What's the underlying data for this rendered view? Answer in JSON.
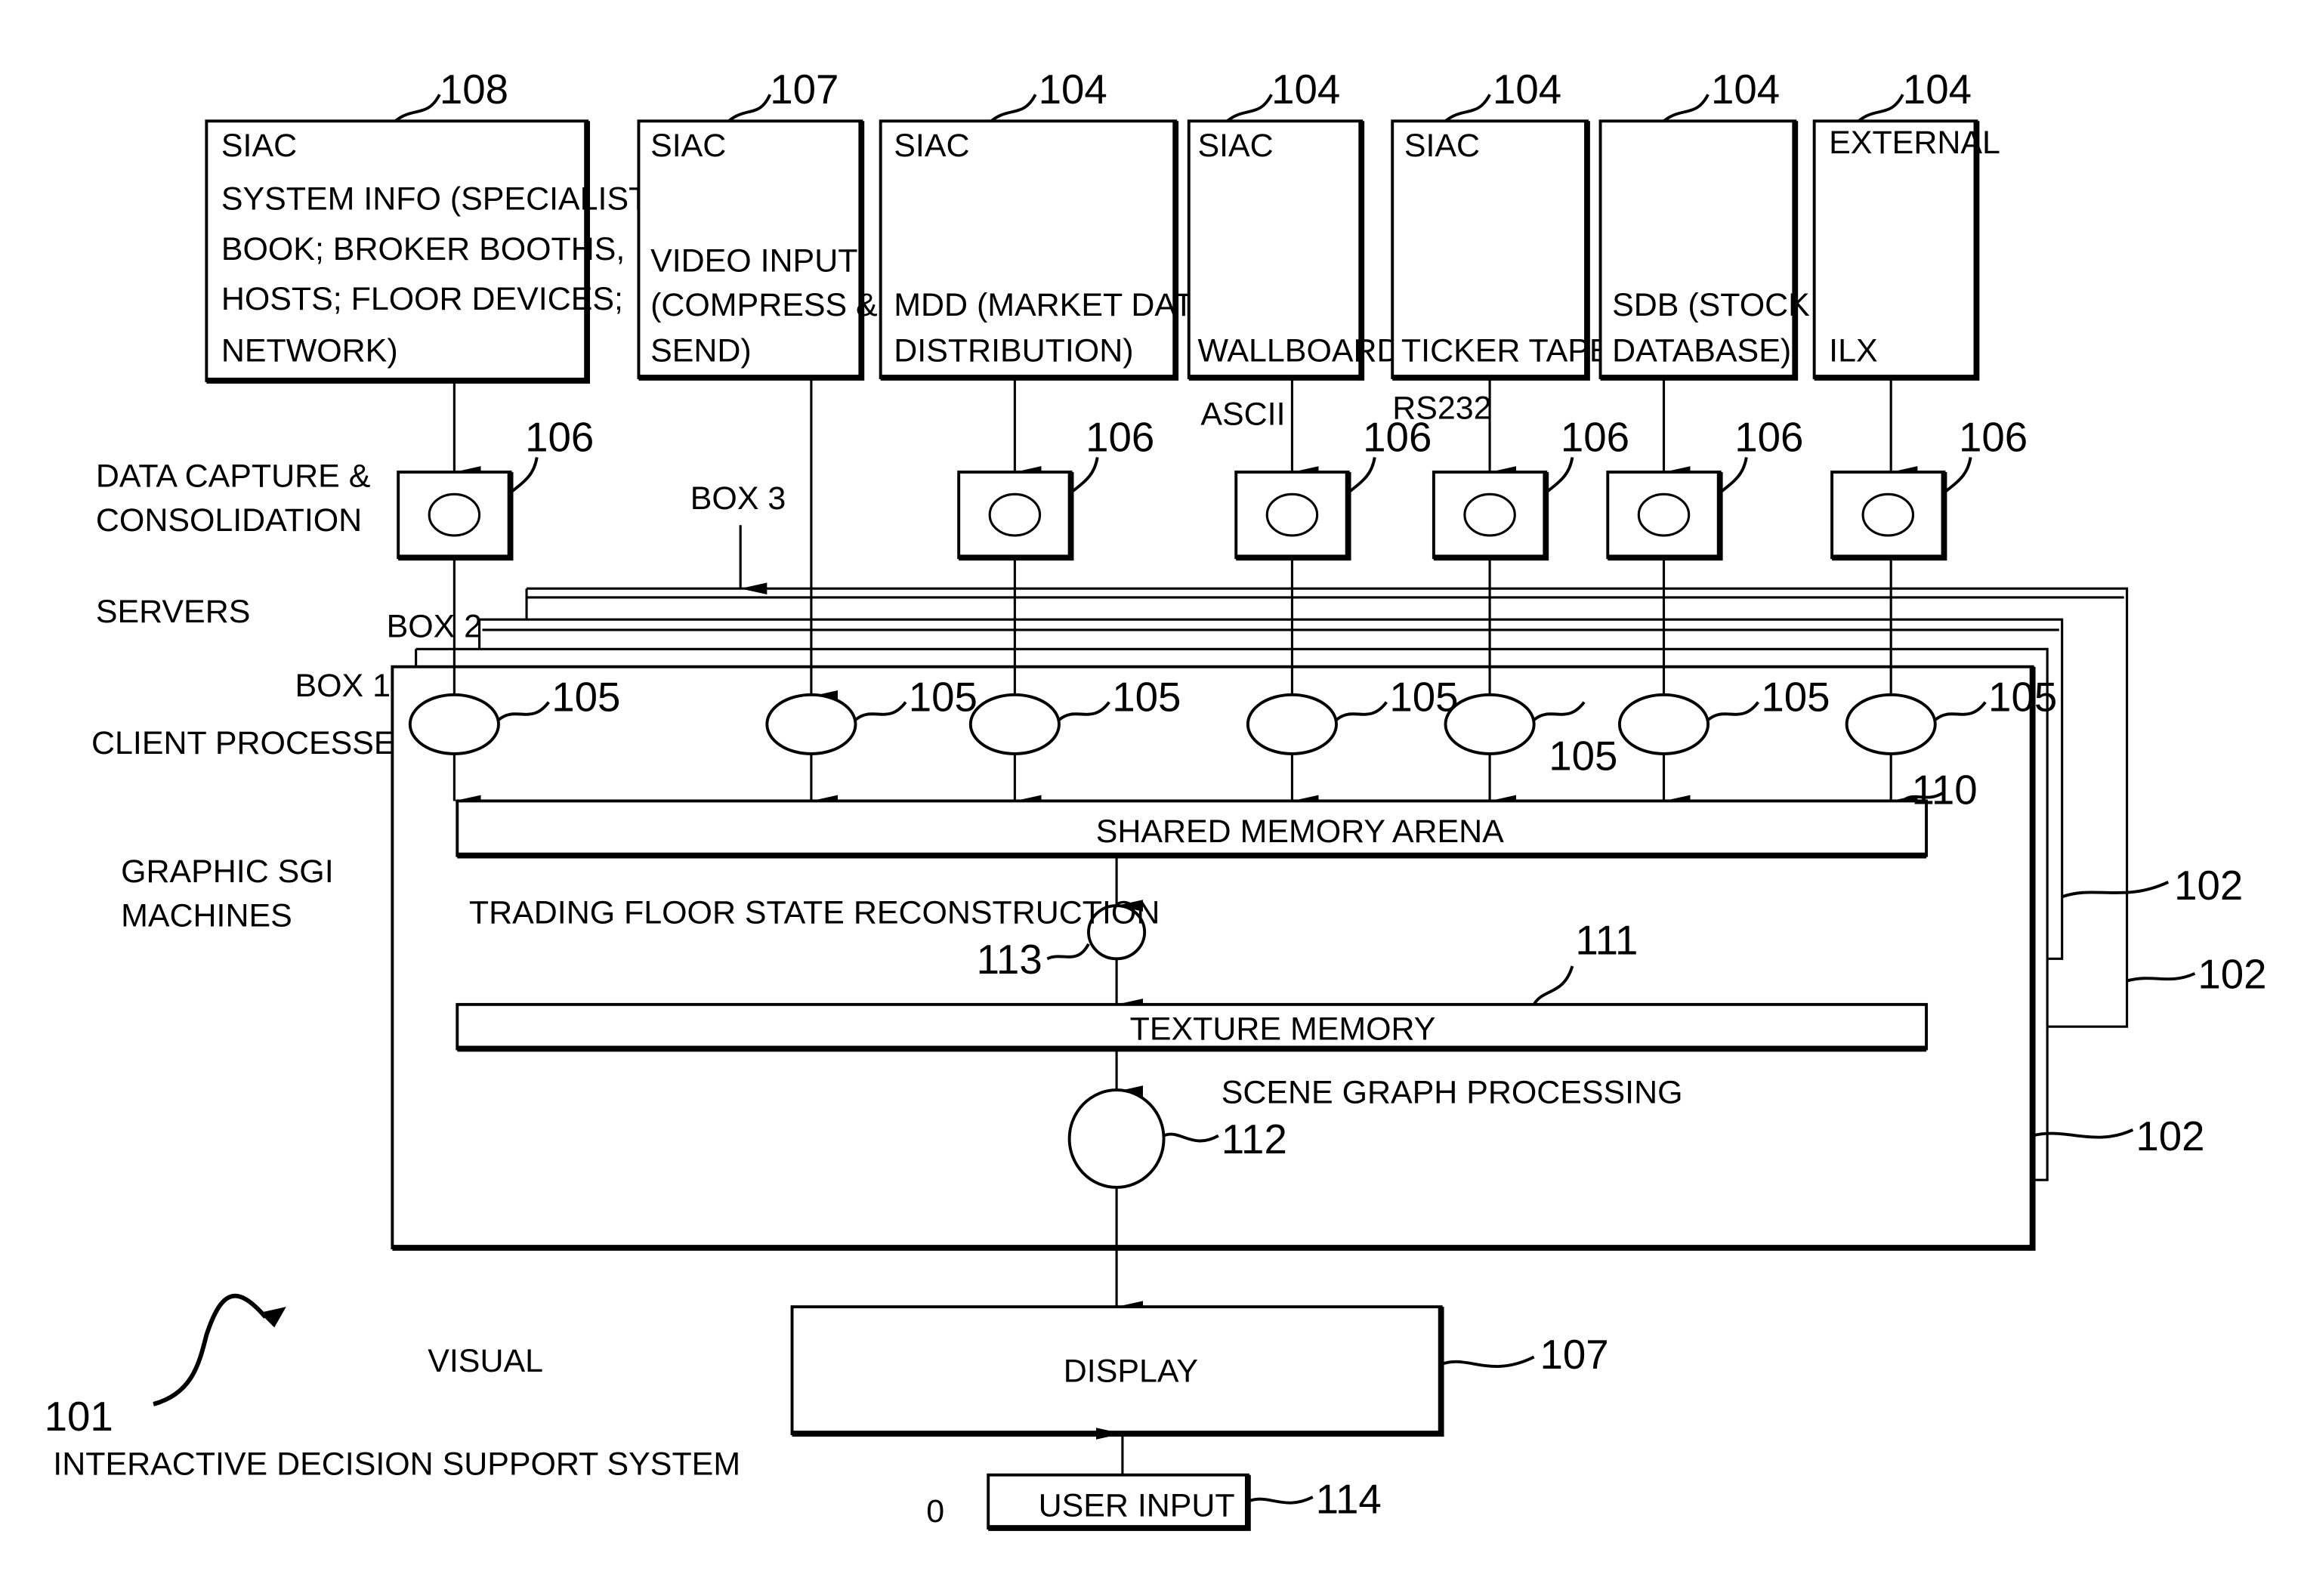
{
  "figure": {
    "title_ref": "101",
    "title": "INTERACTIVE DECISION SUPPORT SYSTEM",
    "visual_label": "VISUAL",
    "small_mark": "0"
  },
  "row_labels": {
    "data_capture": [
      "DATA CAPTURE &",
      "CONSOLIDATION"
    ],
    "servers": "SERVERS",
    "client_processes": "CLIENT PROCESSES",
    "graphic_machines": [
      "GRAPHIC SGI",
      "MACHINES"
    ]
  },
  "sources": [
    {
      "ref": "108",
      "top": "SIAC",
      "lines": [
        "SYSTEM INFO (SPECIALIST",
        "BOOK; BROKER BOOTHS,",
        "HOSTS; FLOOR DEVICES;",
        "NETWORK)"
      ]
    },
    {
      "ref": "107",
      "top": "SIAC",
      "lines": [
        "VIDEO INPUT",
        "(COMPRESS &",
        "SEND)"
      ]
    },
    {
      "ref": "104",
      "top": "SIAC",
      "lines": [
        "MDD (MARKET DATA",
        "DISTRIBUTION)"
      ]
    },
    {
      "ref": "104",
      "top": "SIAC",
      "lines": [
        "WALLBOARD"
      ]
    },
    {
      "ref": "104",
      "top": "SIAC",
      "lines": [
        "TICKER TAPE"
      ]
    },
    {
      "ref": "104",
      "top": "",
      "lines": [
        "SDB (STOCK",
        "DATABASE)"
      ]
    },
    {
      "ref": "104",
      "top": "EXTERNAL",
      "lines": [
        "ILX"
      ]
    }
  ],
  "links": {
    "ascii": "ASCII",
    "rs232": "RS232"
  },
  "capture_ref": "106",
  "server_boxes": {
    "box1": "BOX 1",
    "box2": "BOX 2",
    "box3": "BOX 3",
    "ref": "102"
  },
  "client_ref": "105",
  "shared_memory": {
    "label": "SHARED MEMORY ARENA",
    "ref": "110"
  },
  "reconstruction": {
    "label": "TRADING FLOOR STATE RECONSTRUCTION",
    "ref": "113"
  },
  "texture_memory": {
    "label": "TEXTURE MEMORY",
    "ref": "111"
  },
  "scene_graph": {
    "label": "SCENE GRAPH PROCESSING",
    "ref": "112"
  },
  "display": {
    "label": "DISPLAY",
    "ref": "107"
  },
  "user_input": {
    "label": "USER INPUT",
    "ref": "114"
  }
}
